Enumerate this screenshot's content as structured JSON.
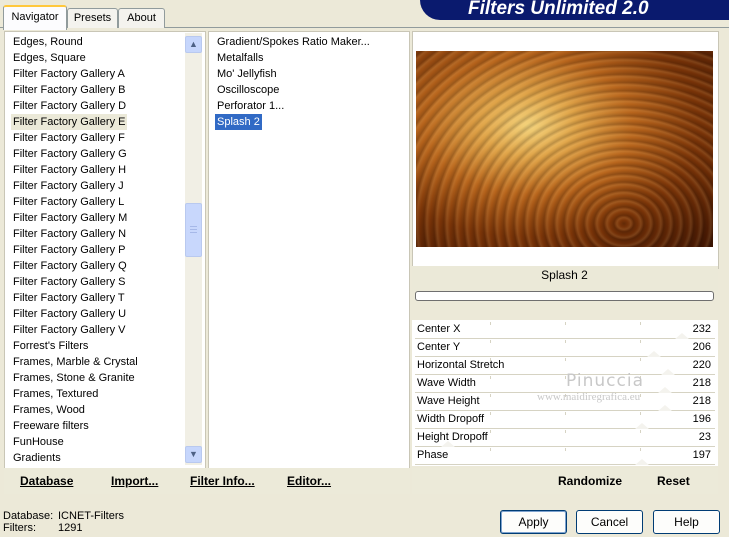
{
  "tabs": [
    {
      "label": "Navigator"
    },
    {
      "label": "Presets"
    },
    {
      "label": "About"
    }
  ],
  "title": "Filters Unlimited 2.0",
  "categories": {
    "items": [
      "Edges, Round",
      "Edges, Square",
      "Filter Factory Gallery A",
      "Filter Factory Gallery B",
      "Filter Factory Gallery D",
      "Filter Factory Gallery E",
      "Filter Factory Gallery F",
      "Filter Factory Gallery G",
      "Filter Factory Gallery H",
      "Filter Factory Gallery J",
      "Filter Factory Gallery L",
      "Filter Factory Gallery M",
      "Filter Factory Gallery N",
      "Filter Factory Gallery P",
      "Filter Factory Gallery Q",
      "Filter Factory Gallery S",
      "Filter Factory Gallery T",
      "Filter Factory Gallery U",
      "Filter Factory Gallery V",
      "Forrest's Filters",
      "Frames, Marble & Crystal",
      "Frames, Stone & Granite",
      "Frames, Textured",
      "Frames, Wood",
      "Freeware filters",
      "FunHouse",
      "Gradients"
    ],
    "selected": "Filter Factory Gallery E"
  },
  "filters": {
    "items": [
      "Gradient/Spokes Ratio Maker...",
      "Metalfalls",
      "Mo' Jellyfish",
      "Oscilloscope",
      "Perforator 1...",
      "Splash 2"
    ],
    "selected": "Splash 2"
  },
  "bottom_links": {
    "database": "Database",
    "import": "Import...",
    "filter_info": "Filter Info...",
    "editor": "Editor...",
    "randomize": "Randomize",
    "reset": "Reset"
  },
  "preview": {
    "filter_name": "Splash 2",
    "progress": 0
  },
  "sliders": [
    {
      "label": "Center X",
      "value": "232",
      "level": 0.91
    },
    {
      "label": "Center Y",
      "value": "206",
      "level": 0.81
    },
    {
      "label": "Horizontal Stretch",
      "value": "220",
      "level": 0.86
    },
    {
      "label": "Wave Width",
      "value": "218",
      "level": 0.85
    },
    {
      "label": "Wave Height",
      "value": "218",
      "level": 0.85
    },
    {
      "label": "Width Dropoff",
      "value": "196",
      "level": 0.77
    },
    {
      "label": "Height Dropoff",
      "value": "23",
      "level": 0.09
    },
    {
      "label": "Phase",
      "value": "197",
      "level": 0.77
    }
  ],
  "watermark": {
    "name": "Pinuccia",
    "site": "www.maidiregrafica.eu"
  },
  "status": {
    "database_label": "Database:",
    "database_value": "ICNET-Filters",
    "filters_label": "Filters:",
    "filters_value": "1291"
  },
  "buttons": {
    "apply": "Apply",
    "cancel": "Cancel",
    "help": "Help"
  },
  "colors": {
    "banner": "#0a1a6e",
    "selection": "#316ac5",
    "tab_highlight": "#ffc83c"
  }
}
